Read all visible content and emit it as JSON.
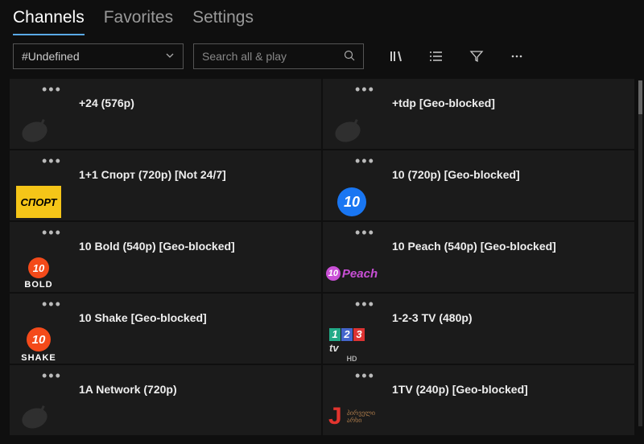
{
  "tabs": {
    "channels": "Channels",
    "favorites": "Favorites",
    "settings": "Settings"
  },
  "filter": {
    "selected": "#Undefined"
  },
  "search": {
    "placeholder": "Search all & play"
  },
  "channels": [
    {
      "title": "+24 (576p)",
      "logo": "dish"
    },
    {
      "title": "+tdp [Geo-blocked]",
      "logo": "dish"
    },
    {
      "title": "1+1 Спорт (720p) [Not 24/7]",
      "logo": "sport"
    },
    {
      "title": "10 (720p) [Geo-blocked]",
      "logo": "ten-blue"
    },
    {
      "title": "10 Bold (540p) [Geo-blocked]",
      "logo": "ten-bold"
    },
    {
      "title": "10 Peach (540p) [Geo-blocked]",
      "logo": "ten-peach"
    },
    {
      "title": "10 Shake [Geo-blocked]",
      "logo": "ten-shake"
    },
    {
      "title": "1-2-3 TV (480p)",
      "logo": "tv123"
    },
    {
      "title": "1A Network (720p)",
      "logo": "dish"
    },
    {
      "title": "1TV (240p) [Geo-blocked]",
      "logo": "onetv"
    }
  ]
}
